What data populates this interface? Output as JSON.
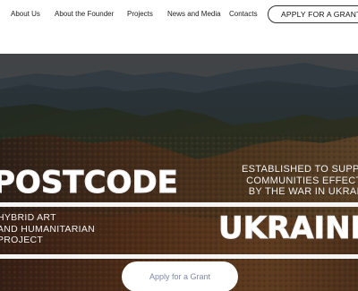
{
  "nav": {
    "links": [
      {
        "label": "About Us"
      },
      {
        "label": "About the Founder"
      },
      {
        "label": "Projects"
      },
      {
        "label": "News and Media"
      },
      {
        "label": "Contacts"
      }
    ],
    "cta_label": "APPLY FOR A GRANT"
  },
  "hero": {
    "title_left": "POSTCODE",
    "title_right": "UKRAINE",
    "tagline_lines": [
      "ESTABLISHED TO SUPPORT",
      "COMMUNITIES EFFECTED",
      "BY THE WAR IN UKRAINE"
    ],
    "subtitle_lines": [
      "HYBRID ART",
      "AND HUMANITARIAN",
      "PROJECT"
    ],
    "cta_label": "Apply for a Grant"
  },
  "colors": {
    "nav_bg": "#ffffff",
    "hero_overlay": "#3b3b3b",
    "forest_dark": "#2c2f25",
    "forest_autumn": "#8a5a2e",
    "cta_text": "#7f8aa8"
  }
}
